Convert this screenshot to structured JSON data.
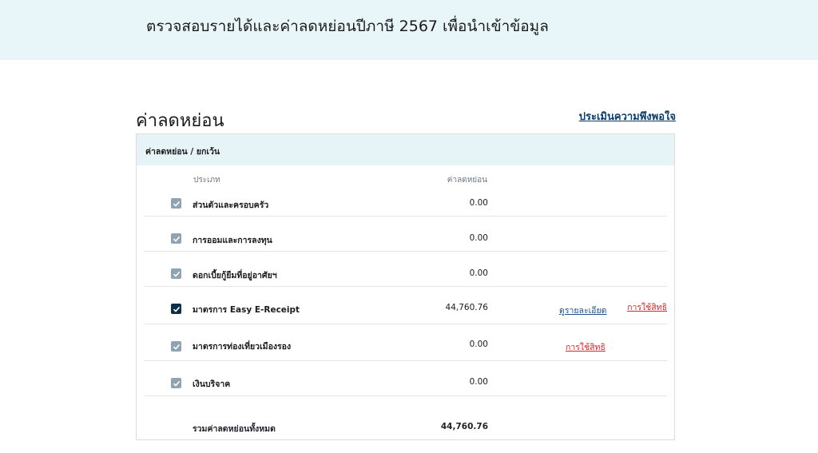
{
  "header": {
    "title": "ตรวจสอบรายได้และค่าลดหย่อนปีภาษี 2567 เพื่อนำเข้าข้อมูล"
  },
  "section": {
    "title": "ค่าลดหย่อน",
    "survey_link": "ประเมินความพึงพอใจ"
  },
  "card": {
    "header": "ค่าลดหย่อน / ยกเว้น",
    "columns": {
      "type": "ประเภท",
      "amount": "ค่าลดหย่อน"
    },
    "rows": [
      {
        "label": "ส่วนตัวและครอบครัว",
        "amount": "0.00",
        "checked": true
      },
      {
        "label": "การออมและการลงทุน",
        "amount": "0.00",
        "checked": true
      },
      {
        "label": "ดอกเบี้ยกู้ยืมที่อยู่อาศัยฯ",
        "amount": "0.00",
        "checked": true
      },
      {
        "label": "มาตรการ Easy E-Receipt",
        "amount": "44,760.76",
        "checked": true,
        "detail_link": "ดูรายละเอียด",
        "use_link": "การใช้สิทธิ"
      },
      {
        "label": "มาตรการท่องเที่ยวเมืองรอง",
        "amount": "0.00",
        "checked": true,
        "use_link": "การใช้สิทธิ"
      },
      {
        "label": "เงินบริจาค",
        "amount": "0.00",
        "checked": true
      }
    ],
    "total": {
      "label": "รวมค่าลดหย่อนทั้งหมด",
      "amount": "44,760.76"
    }
  },
  "colors": {
    "header_bg": "#e8f5f9",
    "checkbox_active": "#0d2f4a",
    "checkbox_disabled": "#8fa4b3",
    "link_blue": "#1a4e8a",
    "link_red": "#e0202a"
  }
}
